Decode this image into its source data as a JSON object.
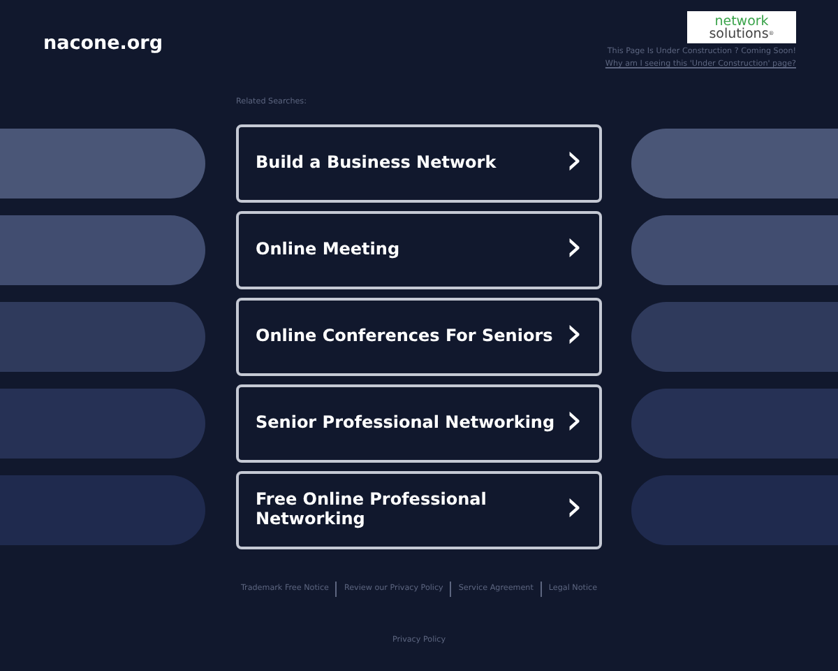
{
  "site_title": "nacone.org",
  "logo": {
    "line_1": "network",
    "line_2": "solutions",
    "mark": "®"
  },
  "notice": "This Page Is Under Construction ? Coming Soon!",
  "notice_link": "Why am I seeing this 'Under Construction' page?",
  "related_label": "Related Searches:",
  "searches": [
    {
      "label": "Build a Business Network",
      "arrow": "›"
    },
    {
      "label": "Online Meeting",
      "arrow": "›"
    },
    {
      "label": "Online Conferences For Seniors",
      "arrow": "›"
    },
    {
      "label": "Senior Professional Networking",
      "arrow": "›"
    },
    {
      "label": "Free Online Professional Networking",
      "arrow": "›"
    }
  ],
  "footer_links": [
    "Trademark Free Notice",
    "Review our Privacy Policy",
    "Service Agreement",
    "Legal Notice"
  ],
  "privacy_link": "Privacy Policy"
}
